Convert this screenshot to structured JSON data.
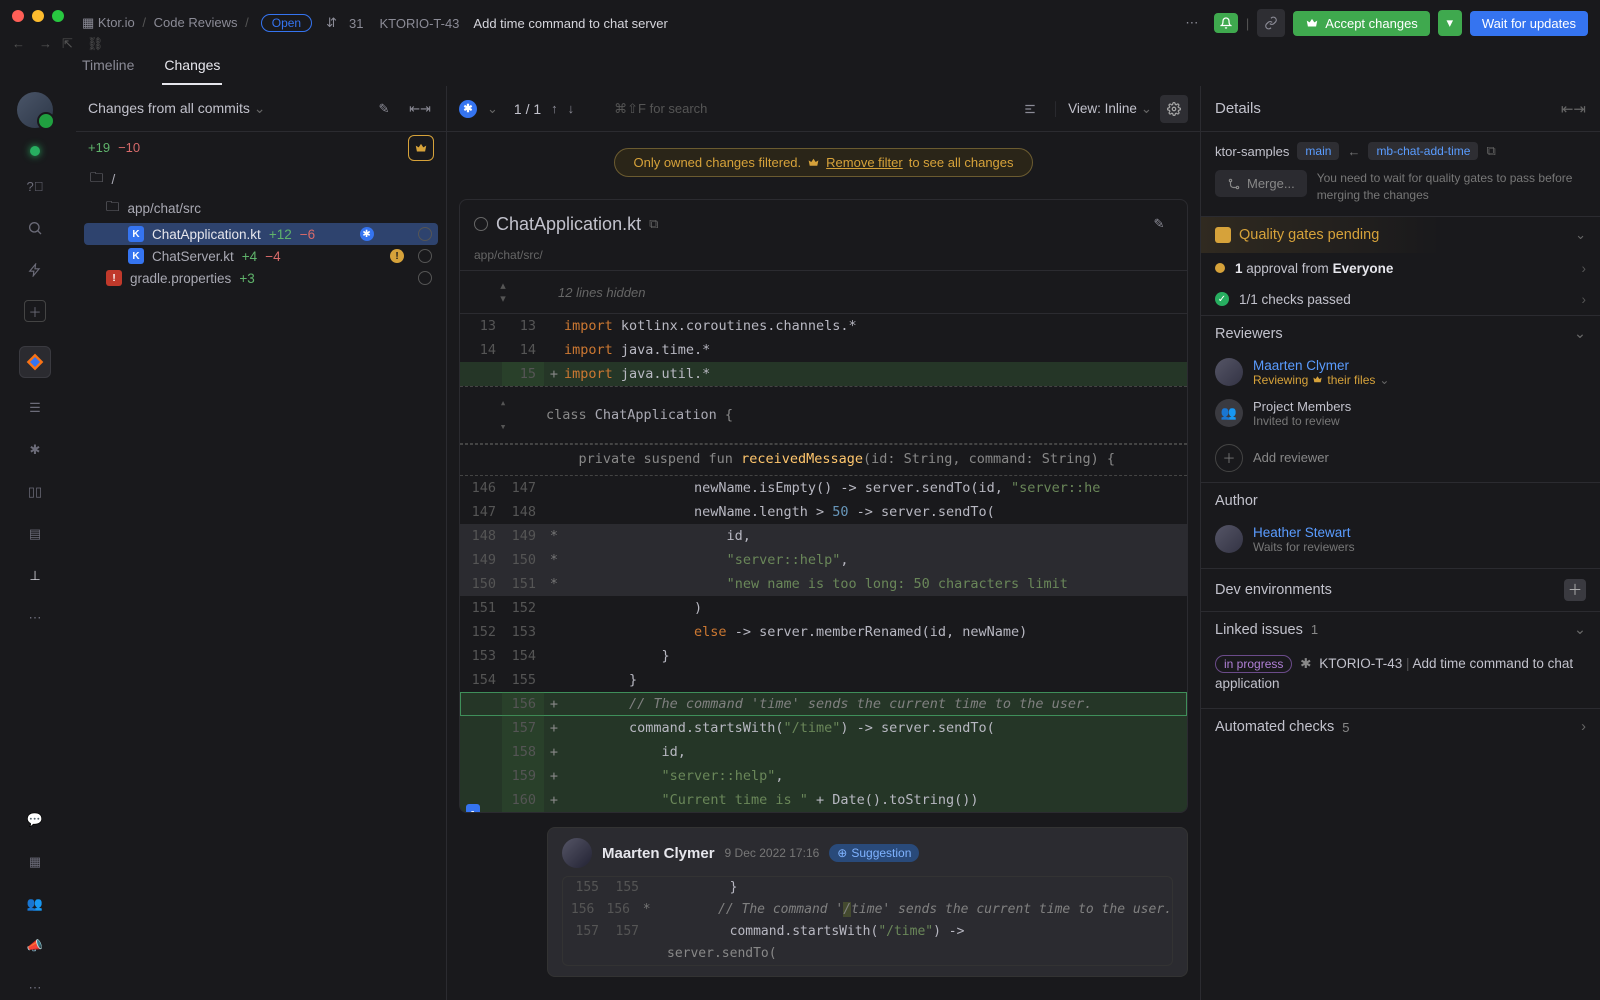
{
  "breadcrumb": {
    "project": "Ktor.io",
    "section": "Code Reviews",
    "status": "Open",
    "mr_count": "31",
    "ticket": "KTORIO-T-43",
    "title": "Add time command to chat server"
  },
  "top": {
    "accept": "Accept changes",
    "wait": "Wait for updates"
  },
  "tabs": {
    "timeline": "Timeline",
    "changes": "Changes"
  },
  "sidebar": {
    "title": "Changes from all commits",
    "plus": "+19",
    "minus": "−10",
    "root": "/",
    "folder": "app/chat/src",
    "files": [
      {
        "name": "ChatApplication.kt",
        "plus": "+12",
        "minus": "−6"
      },
      {
        "name": "ChatServer.kt",
        "plus": "+4",
        "minus": "−4"
      }
    ],
    "file3": {
      "name": "gradle.properties",
      "plus": "+3"
    }
  },
  "center": {
    "counter": "1 / 1",
    "search_hint": "⌘⇧F for search",
    "view": "View: Inline",
    "banner_a": "Only owned changes filtered.",
    "banner_link": "Remove filter",
    "banner_b": "to see all changes",
    "file_title": "ChatApplication.kt",
    "file_path": "app/chat/src/",
    "folded": "12 lines hidden",
    "code": {
      "l13": "import kotlinx.coroutines.channels.*",
      "l14": "import java.time.*",
      "l15": "import java.util.*",
      "cls": "class ChatApplication {",
      "fun": "    private suspend fun receivedMessage(id: String, command: String) {",
      "l146": "                newName.isEmpty() -> server.sendTo(id, \"server::he",
      "l147": "                newName.length > 50 -> server.sendTo(",
      "l148": "                    id,",
      "l149": "                    \"server::help\",",
      "l150": "                    \"new name is too long: 50 characters limit",
      "l151": "                )",
      "l152": "                else -> server.memberRenamed(id, newName)",
      "l153": "            }",
      "l154": "        }",
      "a156": "        // The command 'time' sends the current time to the user.",
      "a157": "        command.startsWith(\"/time\") -> server.sendTo(",
      "a158": "            id,",
      "a159": "            \"server::help\",",
      "a160": "            \"Current time is \" + Date().toString())"
    },
    "comment": {
      "name": "Maarten Clymer",
      "time": "9 Dec 2022 17:16",
      "badge": "Suggestion",
      "c1_old": "155",
      "c1_new": "155",
      "c1": "        }",
      "c2_old": "156",
      "c2_new": "156",
      "c2_marker": "*",
      "c2": "        // The command '/time' sends the current time to the user.",
      "c3_old": "157",
      "c3_new": "157",
      "c3": "        command.startsWith(\"/time\") ->",
      "c4": "server.sendTo("
    }
  },
  "details": {
    "title": "Details",
    "repo": "ktor-samples",
    "base": "main",
    "branch": "mb-chat-add-time",
    "merge": "Merge...",
    "merge_hint": "You need to wait for quality gates to pass before merging the changes",
    "qg": "Quality gates pending",
    "approval_count": "1",
    "approval_text": " approval from ",
    "approval_group": "Everyone",
    "checks": "1/1 checks passed",
    "reviewers_title": "Reviewers",
    "rev1": {
      "name": "Maarten Clymer",
      "status": "Reviewing",
      "suffix": "their files"
    },
    "rev2": {
      "name": "Project Members",
      "status": "Invited to review"
    },
    "add_reviewer": "Add reviewer",
    "author_title": "Author",
    "author": {
      "name": "Heather Stewart",
      "status": "Waits for reviewers"
    },
    "dev_env": "Dev environments",
    "linked_title": "Linked issues",
    "linked_count": "1",
    "issue_status": "in progress",
    "issue_id": "KTORIO-T-43",
    "issue_title": "Add time command to chat application",
    "auto_checks": "Automated checks",
    "auto_count": "5"
  }
}
